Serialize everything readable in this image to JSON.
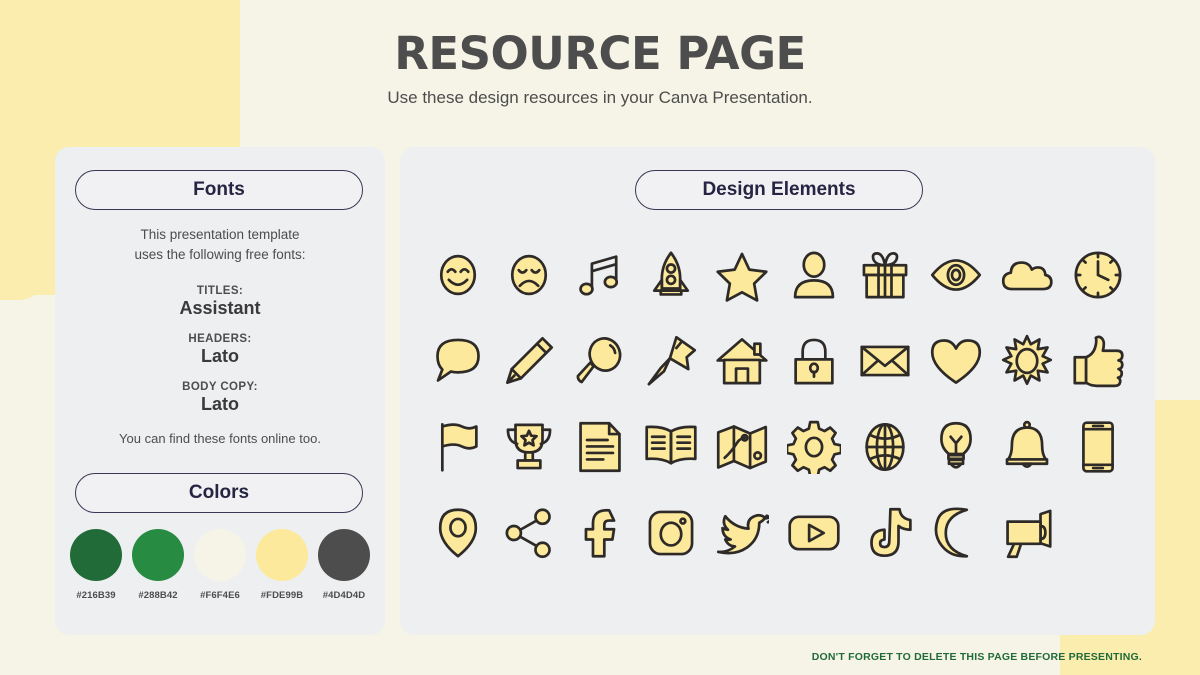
{
  "header": {
    "title": "RESOURCE PAGE",
    "subtitle": "Use these design resources in your Canva Presentation."
  },
  "fonts_panel": {
    "heading": "Fonts",
    "intro_line1": "This presentation template",
    "intro_line2": "uses the following free fonts:",
    "groups": [
      {
        "label": "TITLES:",
        "name": "Assistant"
      },
      {
        "label": "HEADERS:",
        "name": "Lato"
      },
      {
        "label": "BODY COPY:",
        "name": "Lato"
      }
    ],
    "outro": "You can find these fonts online too."
  },
  "colors_panel": {
    "heading": "Colors",
    "swatches": [
      {
        "hex": "#216B39",
        "label": "#216B39"
      },
      {
        "hex": "#288B42",
        "label": "#288B42"
      },
      {
        "hex": "#F6F4E6",
        "label": "#F6F4E6"
      },
      {
        "hex": "#FDE99B",
        "label": "#FDE99B"
      },
      {
        "hex": "#4D4D4D",
        "label": "#4D4D4D"
      }
    ]
  },
  "elements_panel": {
    "heading": "Design Elements",
    "icons": [
      "smiley-face-icon",
      "sad-face-icon",
      "music-note-icon",
      "rocket-icon",
      "star-icon",
      "person-icon",
      "gift-icon",
      "eye-icon",
      "cloud-icon",
      "clock-icon",
      "speech-bubble-icon",
      "pencil-icon",
      "magnifying-glass-icon",
      "pushpin-icon",
      "house-icon",
      "lock-icon",
      "envelope-icon",
      "heart-icon",
      "sun-icon",
      "thumbs-up-icon",
      "flag-icon",
      "trophy-icon",
      "document-icon",
      "book-icon",
      "map-icon",
      "gear-icon",
      "globe-icon",
      "lightbulb-icon",
      "bell-icon",
      "phone-icon",
      "location-pin-icon",
      "share-icon",
      "facebook-icon",
      "instagram-icon",
      "twitter-icon",
      "youtube-icon",
      "tiktok-icon",
      "moon-icon",
      "megaphone-icon"
    ]
  },
  "footer": {
    "note": "DON'T FORGET TO DELETE THIS PAGE BEFORE PRESENTING."
  },
  "theme": {
    "background": "#F6F4E6",
    "panel_bg": "#EEEFF1",
    "accent_yellow": "#FDE99B",
    "blob_yellow": "#FAEDAE",
    "dark": "#4D4D4D",
    "outline": "#2E2A27",
    "green": "#216B39",
    "pill_border": "#3B3655"
  }
}
